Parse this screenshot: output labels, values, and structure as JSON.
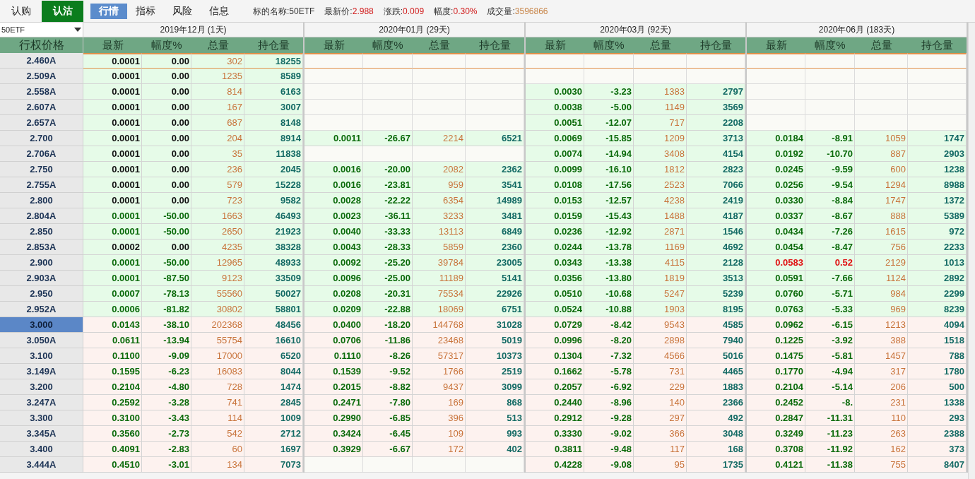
{
  "option_tabs": [
    {
      "label": "认购",
      "selected": false
    },
    {
      "label": "认沽",
      "selected": true
    }
  ],
  "view_tabs": [
    {
      "label": "行情",
      "selected": true
    },
    {
      "label": "指标",
      "selected": false
    },
    {
      "label": "风险",
      "selected": false
    },
    {
      "label": "信息",
      "selected": false
    }
  ],
  "quote": [
    {
      "label": "标的名称:",
      "value": "50ETF",
      "kind": "plain"
    },
    {
      "label": "最新价:",
      "value": "2.988",
      "kind": "price"
    },
    {
      "label": "涨跌:",
      "value": "0.009",
      "kind": "price"
    },
    {
      "label": "幅度:",
      "value": "0.30%",
      "kind": "price"
    },
    {
      "label": "成交量:",
      "value": "3596866",
      "kind": "volume"
    }
  ],
  "underlying_select": {
    "value": "50ETF"
  },
  "strike_header": "行权价格",
  "expiries": [
    {
      "title": "2019年12月 (1天)",
      "columns": [
        "最新",
        "幅度%",
        "总量",
        "持仓量"
      ]
    },
    {
      "title": "2020年01月 (29天)",
      "columns": [
        "最新",
        "幅度%",
        "总量",
        "持仓量"
      ]
    },
    {
      "title": "2020年03月 (92天)",
      "columns": [
        "最新",
        "幅度%",
        "总量",
        "持仓量"
      ]
    },
    {
      "title": "2020年06月 (183天)",
      "columns": [
        "最新",
        "幅度%",
        "总量",
        "持仓量"
      ]
    }
  ],
  "rows": [
    {
      "strike": "2.460A",
      "selected": false,
      "focused": true,
      "in_the_money": false,
      "quotes": [
        {
          "kind": "quote",
          "last": "0.0001",
          "chg": "0.00",
          "vol": "302",
          "oi": "18255",
          "color": "#111111"
        },
        {
          "kind": "blank"
        },
        {
          "kind": "blank"
        },
        {
          "kind": "blank"
        }
      ]
    },
    {
      "strike": "2.509A",
      "selected": false,
      "focused": false,
      "in_the_money": false,
      "quotes": [
        {
          "kind": "quote",
          "last": "0.0001",
          "chg": "0.00",
          "vol": "1235",
          "oi": "8589",
          "color": "#111111"
        },
        {
          "kind": "blank"
        },
        {
          "kind": "blank"
        },
        {
          "kind": "blank"
        }
      ]
    },
    {
      "strike": "2.558A",
      "selected": false,
      "focused": false,
      "in_the_money": false,
      "quotes": [
        {
          "kind": "quote",
          "last": "0.0001",
          "chg": "0.00",
          "vol": "814",
          "oi": "6163",
          "color": "#111111"
        },
        {
          "kind": "blank"
        },
        {
          "kind": "quote",
          "last": "0.0030",
          "chg": "-3.23",
          "vol": "1383",
          "oi": "2797",
          "color": "#0a6a0a"
        },
        {
          "kind": "blank"
        }
      ]
    },
    {
      "strike": "2.607A",
      "selected": false,
      "focused": false,
      "in_the_money": false,
      "quotes": [
        {
          "kind": "quote",
          "last": "0.0001",
          "chg": "0.00",
          "vol": "167",
          "oi": "3007",
          "color": "#111111"
        },
        {
          "kind": "blank"
        },
        {
          "kind": "quote",
          "last": "0.0038",
          "chg": "-5.00",
          "vol": "1149",
          "oi": "3569",
          "color": "#0a6a0a"
        },
        {
          "kind": "blank"
        }
      ]
    },
    {
      "strike": "2.657A",
      "selected": false,
      "focused": false,
      "in_the_money": false,
      "quotes": [
        {
          "kind": "quote",
          "last": "0.0001",
          "chg": "0.00",
          "vol": "687",
          "oi": "8148",
          "color": "#111111"
        },
        {
          "kind": "blank"
        },
        {
          "kind": "quote",
          "last": "0.0051",
          "chg": "-12.07",
          "vol": "717",
          "oi": "2208",
          "color": "#0a6a0a"
        },
        {
          "kind": "blank"
        }
      ]
    },
    {
      "strike": "2.700",
      "selected": false,
      "focused": false,
      "in_the_money": false,
      "quotes": [
        {
          "kind": "quote",
          "last": "0.0001",
          "chg": "0.00",
          "vol": "204",
          "oi": "8914",
          "color": "#111111"
        },
        {
          "kind": "quote",
          "last": "0.0011",
          "chg": "-26.67",
          "vol": "2214",
          "oi": "6521",
          "color": "#0a6a0a"
        },
        {
          "kind": "quote",
          "last": "0.0069",
          "chg": "-15.85",
          "vol": "1209",
          "oi": "3713",
          "color": "#0a6a0a"
        },
        {
          "kind": "quote",
          "last": "0.0184",
          "chg": "-8.91",
          "vol": "1059",
          "oi": "1747",
          "color": "#0a6a0a"
        }
      ]
    },
    {
      "strike": "2.706A",
      "selected": false,
      "focused": false,
      "in_the_money": false,
      "quotes": [
        {
          "kind": "quote",
          "last": "0.0001",
          "chg": "0.00",
          "vol": "35",
          "oi": "11838",
          "color": "#111111"
        },
        {
          "kind": "blank"
        },
        {
          "kind": "quote",
          "last": "0.0074",
          "chg": "-14.94",
          "vol": "3408",
          "oi": "4154",
          "color": "#0a6a0a"
        },
        {
          "kind": "quote",
          "last": "0.0192",
          "chg": "-10.70",
          "vol": "887",
          "oi": "2903",
          "color": "#0a6a0a"
        }
      ]
    },
    {
      "strike": "2.750",
      "selected": false,
      "focused": false,
      "in_the_money": false,
      "quotes": [
        {
          "kind": "quote",
          "last": "0.0001",
          "chg": "0.00",
          "vol": "236",
          "oi": "2045",
          "color": "#111111"
        },
        {
          "kind": "quote",
          "last": "0.0016",
          "chg": "-20.00",
          "vol": "2082",
          "oi": "2362",
          "color": "#0a6a0a"
        },
        {
          "kind": "quote",
          "last": "0.0099",
          "chg": "-16.10",
          "vol": "1812",
          "oi": "2823",
          "color": "#0a6a0a"
        },
        {
          "kind": "quote",
          "last": "0.0245",
          "chg": "-9.59",
          "vol": "600",
          "oi": "1238",
          "color": "#0a6a0a"
        }
      ]
    },
    {
      "strike": "2.755A",
      "selected": false,
      "focused": false,
      "in_the_money": false,
      "quotes": [
        {
          "kind": "quote",
          "last": "0.0001",
          "chg": "0.00",
          "vol": "579",
          "oi": "15228",
          "color": "#111111"
        },
        {
          "kind": "quote",
          "last": "0.0016",
          "chg": "-23.81",
          "vol": "959",
          "oi": "3541",
          "color": "#0a6a0a"
        },
        {
          "kind": "quote",
          "last": "0.0108",
          "chg": "-17.56",
          "vol": "2523",
          "oi": "7066",
          "color": "#0a6a0a"
        },
        {
          "kind": "quote",
          "last": "0.0256",
          "chg": "-9.54",
          "vol": "1294",
          "oi": "8988",
          "color": "#0a6a0a"
        }
      ]
    },
    {
      "strike": "2.800",
      "selected": false,
      "focused": false,
      "in_the_money": false,
      "quotes": [
        {
          "kind": "quote",
          "last": "0.0001",
          "chg": "0.00",
          "vol": "723",
          "oi": "9582",
          "color": "#111111"
        },
        {
          "kind": "quote",
          "last": "0.0028",
          "chg": "-22.22",
          "vol": "6354",
          "oi": "14989",
          "color": "#0a6a0a"
        },
        {
          "kind": "quote",
          "last": "0.0153",
          "chg": "-12.57",
          "vol": "4238",
          "oi": "2419",
          "color": "#0a6a0a"
        },
        {
          "kind": "quote",
          "last": "0.0330",
          "chg": "-8.84",
          "vol": "1747",
          "oi": "1372",
          "color": "#0a6a0a"
        }
      ]
    },
    {
      "strike": "2.804A",
      "selected": false,
      "focused": false,
      "in_the_money": false,
      "quotes": [
        {
          "kind": "quote",
          "last": "0.0001",
          "chg": "-50.00",
          "vol": "1663",
          "oi": "46493",
          "color": "#0a6a0a"
        },
        {
          "kind": "quote",
          "last": "0.0023",
          "chg": "-36.11",
          "vol": "3233",
          "oi": "3481",
          "color": "#0a6a0a"
        },
        {
          "kind": "quote",
          "last": "0.0159",
          "chg": "-15.43",
          "vol": "1488",
          "oi": "4187",
          "color": "#0a6a0a"
        },
        {
          "kind": "quote",
          "last": "0.0337",
          "chg": "-8.67",
          "vol": "888",
          "oi": "5389",
          "color": "#0a6a0a"
        }
      ]
    },
    {
      "strike": "2.850",
      "selected": false,
      "focused": false,
      "in_the_money": false,
      "quotes": [
        {
          "kind": "quote",
          "last": "0.0001",
          "chg": "-50.00",
          "vol": "2650",
          "oi": "21923",
          "color": "#0a6a0a"
        },
        {
          "kind": "quote",
          "last": "0.0040",
          "chg": "-33.33",
          "vol": "13113",
          "oi": "6849",
          "color": "#0a6a0a"
        },
        {
          "kind": "quote",
          "last": "0.0236",
          "chg": "-12.92",
          "vol": "2871",
          "oi": "1546",
          "color": "#0a6a0a"
        },
        {
          "kind": "quote",
          "last": "0.0434",
          "chg": "-7.26",
          "vol": "1615",
          "oi": "972",
          "color": "#0a6a0a"
        }
      ]
    },
    {
      "strike": "2.853A",
      "selected": false,
      "focused": false,
      "in_the_money": false,
      "quotes": [
        {
          "kind": "quote",
          "last": "0.0002",
          "chg": "0.00",
          "vol": "4235",
          "oi": "38328",
          "color": "#111111"
        },
        {
          "kind": "quote",
          "last": "0.0043",
          "chg": "-28.33",
          "vol": "5859",
          "oi": "2360",
          "color": "#0a6a0a"
        },
        {
          "kind": "quote",
          "last": "0.0244",
          "chg": "-13.78",
          "vol": "1169",
          "oi": "4692",
          "color": "#0a6a0a"
        },
        {
          "kind": "quote",
          "last": "0.0454",
          "chg": "-8.47",
          "vol": "756",
          "oi": "2233",
          "color": "#0a6a0a"
        }
      ]
    },
    {
      "strike": "2.900",
      "selected": false,
      "focused": false,
      "in_the_money": false,
      "quotes": [
        {
          "kind": "quote",
          "last": "0.0001",
          "chg": "-50.00",
          "vol": "12965",
          "oi": "48933",
          "color": "#0a6a0a"
        },
        {
          "kind": "quote",
          "last": "0.0092",
          "chg": "-25.20",
          "vol": "39784",
          "oi": "23005",
          "color": "#0a6a0a"
        },
        {
          "kind": "quote",
          "last": "0.0343",
          "chg": "-13.38",
          "vol": "4115",
          "oi": "2128",
          "color": "#0a6a0a"
        },
        {
          "kind": "quote",
          "last": "0.0583",
          "chg": "0.52",
          "vol": "2129",
          "oi": "1013",
          "color": "#e01010"
        }
      ]
    },
    {
      "strike": "2.903A",
      "selected": false,
      "focused": false,
      "in_the_money": false,
      "quotes": [
        {
          "kind": "quote",
          "last": "0.0001",
          "chg": "-87.50",
          "vol": "9123",
          "oi": "33509",
          "color": "#0a6a0a"
        },
        {
          "kind": "quote",
          "last": "0.0096",
          "chg": "-25.00",
          "vol": "11189",
          "oi": "5141",
          "color": "#0a6a0a"
        },
        {
          "kind": "quote",
          "last": "0.0356",
          "chg": "-13.80",
          "vol": "1819",
          "oi": "3513",
          "color": "#0a6a0a"
        },
        {
          "kind": "quote",
          "last": "0.0591",
          "chg": "-7.66",
          "vol": "1124",
          "oi": "2892",
          "color": "#0a6a0a"
        }
      ]
    },
    {
      "strike": "2.950",
      "selected": false,
      "focused": false,
      "in_the_money": false,
      "quotes": [
        {
          "kind": "quote",
          "last": "0.0007",
          "chg": "-78.13",
          "vol": "55560",
          "oi": "50027",
          "color": "#0a6a0a"
        },
        {
          "kind": "quote",
          "last": "0.0208",
          "chg": "-20.31",
          "vol": "75534",
          "oi": "22926",
          "color": "#0a6a0a"
        },
        {
          "kind": "quote",
          "last": "0.0510",
          "chg": "-10.68",
          "vol": "5247",
          "oi": "5239",
          "color": "#0a6a0a"
        },
        {
          "kind": "quote",
          "last": "0.0760",
          "chg": "-5.71",
          "vol": "984",
          "oi": "2299",
          "color": "#0a6a0a"
        }
      ]
    },
    {
      "strike": "2.952A",
      "selected": false,
      "focused": false,
      "in_the_money": false,
      "quotes": [
        {
          "kind": "quote",
          "last": "0.0006",
          "chg": "-81.82",
          "vol": "30802",
          "oi": "58801",
          "color": "#0a6a0a"
        },
        {
          "kind": "quote",
          "last": "0.0209",
          "chg": "-22.88",
          "vol": "18069",
          "oi": "6751",
          "color": "#0a6a0a"
        },
        {
          "kind": "quote",
          "last": "0.0524",
          "chg": "-10.88",
          "vol": "1903",
          "oi": "8195",
          "color": "#0a6a0a"
        },
        {
          "kind": "quote",
          "last": "0.0763",
          "chg": "-5.33",
          "vol": "969",
          "oi": "8239",
          "color": "#0a6a0a"
        }
      ]
    },
    {
      "strike": "3.000",
      "selected": true,
      "focused": false,
      "in_the_money": true,
      "quotes": [
        {
          "kind": "quote",
          "last": "0.0143",
          "chg": "-38.10",
          "vol": "202368",
          "oi": "48456",
          "color": "#0a6a0a"
        },
        {
          "kind": "quote",
          "last": "0.0400",
          "chg": "-18.20",
          "vol": "144768",
          "oi": "31028",
          "color": "#0a6a0a"
        },
        {
          "kind": "quote",
          "last": "0.0729",
          "chg": "-8.42",
          "vol": "9543",
          "oi": "4585",
          "color": "#0a6a0a"
        },
        {
          "kind": "quote",
          "last": "0.0962",
          "chg": "-6.15",
          "vol": "1213",
          "oi": "4094",
          "color": "#0a6a0a"
        }
      ]
    },
    {
      "strike": "3.050A",
      "selected": false,
      "focused": false,
      "in_the_money": true,
      "quotes": [
        {
          "kind": "quote",
          "last": "0.0611",
          "chg": "-13.94",
          "vol": "55754",
          "oi": "16610",
          "color": "#0a6a0a"
        },
        {
          "kind": "quote",
          "last": "0.0706",
          "chg": "-11.86",
          "vol": "23468",
          "oi": "5019",
          "color": "#0a6a0a"
        },
        {
          "kind": "quote",
          "last": "0.0996",
          "chg": "-8.20",
          "vol": "2898",
          "oi": "7940",
          "color": "#0a6a0a"
        },
        {
          "kind": "quote",
          "last": "0.1225",
          "chg": "-3.92",
          "vol": "388",
          "oi": "1518",
          "color": "#0a6a0a"
        }
      ]
    },
    {
      "strike": "3.100",
      "selected": false,
      "focused": false,
      "in_the_money": true,
      "quotes": [
        {
          "kind": "quote",
          "last": "0.1100",
          "chg": "-9.09",
          "vol": "17000",
          "oi": "6520",
          "color": "#0a6a0a"
        },
        {
          "kind": "quote",
          "last": "0.1110",
          "chg": "-8.26",
          "vol": "57317",
          "oi": "10373",
          "color": "#0a6a0a"
        },
        {
          "kind": "quote",
          "last": "0.1304",
          "chg": "-7.32",
          "vol": "4566",
          "oi": "5016",
          "color": "#0a6a0a"
        },
        {
          "kind": "quote",
          "last": "0.1475",
          "chg": "-5.81",
          "vol": "1457",
          "oi": "788",
          "color": "#0a6a0a"
        }
      ]
    },
    {
      "strike": "3.149A",
      "selected": false,
      "focused": false,
      "in_the_money": true,
      "quotes": [
        {
          "kind": "quote",
          "last": "0.1595",
          "chg": "-6.23",
          "vol": "16083",
          "oi": "8044",
          "color": "#0a6a0a"
        },
        {
          "kind": "quote",
          "last": "0.1539",
          "chg": "-9.52",
          "vol": "1766",
          "oi": "2519",
          "color": "#0a6a0a"
        },
        {
          "kind": "quote",
          "last": "0.1662",
          "chg": "-5.78",
          "vol": "731",
          "oi": "4465",
          "color": "#0a6a0a"
        },
        {
          "kind": "quote",
          "last": "0.1770",
          "chg": "-4.94",
          "vol": "317",
          "oi": "1780",
          "color": "#0a6a0a"
        }
      ]
    },
    {
      "strike": "3.200",
      "selected": false,
      "focused": false,
      "in_the_money": true,
      "quotes": [
        {
          "kind": "quote",
          "last": "0.2104",
          "chg": "-4.80",
          "vol": "728",
          "oi": "1474",
          "color": "#0a6a0a"
        },
        {
          "kind": "quote",
          "last": "0.2015",
          "chg": "-8.82",
          "vol": "9437",
          "oi": "3099",
          "color": "#0a6a0a"
        },
        {
          "kind": "quote",
          "last": "0.2057",
          "chg": "-6.92",
          "vol": "229",
          "oi": "1883",
          "color": "#0a6a0a"
        },
        {
          "kind": "quote",
          "last": "0.2104",
          "chg": "-5.14",
          "vol": "206",
          "oi": "500",
          "color": "#0a6a0a"
        }
      ]
    },
    {
      "strike": "3.247A",
      "selected": false,
      "focused": false,
      "in_the_money": true,
      "quotes": [
        {
          "kind": "quote",
          "last": "0.2592",
          "chg": "-3.28",
          "vol": "741",
          "oi": "2845",
          "color": "#0a6a0a"
        },
        {
          "kind": "quote",
          "last": "0.2471",
          "chg": "-7.80",
          "vol": "169",
          "oi": "868",
          "color": "#0a6a0a"
        },
        {
          "kind": "quote",
          "last": "0.2440",
          "chg": "-8.96",
          "vol": "140",
          "oi": "2366",
          "color": "#0a6a0a"
        },
        {
          "kind": "quote",
          "last": "0.2452",
          "chg": "-8.",
          "vol": "231",
          "oi": "1338",
          "color": "#0a6a0a"
        }
      ]
    },
    {
      "strike": "3.300",
      "selected": false,
      "focused": false,
      "in_the_money": true,
      "quotes": [
        {
          "kind": "quote",
          "last": "0.3100",
          "chg": "-3.43",
          "vol": "114",
          "oi": "1009",
          "color": "#0a6a0a"
        },
        {
          "kind": "quote",
          "last": "0.2990",
          "chg": "-6.85",
          "vol": "396",
          "oi": "513",
          "color": "#0a6a0a"
        },
        {
          "kind": "quote",
          "last": "0.2912",
          "chg": "-9.28",
          "vol": "297",
          "oi": "492",
          "color": "#0a6a0a"
        },
        {
          "kind": "quote",
          "last": "0.2847",
          "chg": "-11.31",
          "vol": "110",
          "oi": "293",
          "color": "#0a6a0a"
        }
      ]
    },
    {
      "strike": "3.345A",
      "selected": false,
      "focused": false,
      "in_the_money": true,
      "quotes": [
        {
          "kind": "quote",
          "last": "0.3560",
          "chg": "-2.73",
          "vol": "542",
          "oi": "2712",
          "color": "#0a6a0a"
        },
        {
          "kind": "quote",
          "last": "0.3424",
          "chg": "-6.45",
          "vol": "109",
          "oi": "993",
          "color": "#0a6a0a"
        },
        {
          "kind": "quote",
          "last": "0.3330",
          "chg": "-9.02",
          "vol": "366",
          "oi": "3048",
          "color": "#0a6a0a"
        },
        {
          "kind": "quote",
          "last": "0.3249",
          "chg": "-11.23",
          "vol": "263",
          "oi": "2388",
          "color": "#0a6a0a"
        }
      ]
    },
    {
      "strike": "3.400",
      "selected": false,
      "focused": false,
      "in_the_money": true,
      "quotes": [
        {
          "kind": "quote",
          "last": "0.4091",
          "chg": "-2.83",
          "vol": "60",
          "oi": "1697",
          "color": "#0a6a0a"
        },
        {
          "kind": "quote",
          "last": "0.3929",
          "chg": "-6.67",
          "vol": "172",
          "oi": "402",
          "color": "#0a6a0a"
        },
        {
          "kind": "quote",
          "last": "0.3811",
          "chg": "-9.48",
          "vol": "117",
          "oi": "168",
          "color": "#0a6a0a"
        },
        {
          "kind": "quote",
          "last": "0.3708",
          "chg": "-11.92",
          "vol": "162",
          "oi": "373",
          "color": "#0a6a0a"
        }
      ]
    },
    {
      "strike": "3.444A",
      "selected": false,
      "focused": false,
      "in_the_money": true,
      "quotes": [
        {
          "kind": "quote",
          "last": "0.4510",
          "chg": "-3.01",
          "vol": "134",
          "oi": "7073",
          "color": "#0a6a0a"
        },
        {
          "kind": "blank"
        },
        {
          "kind": "quote",
          "last": "0.4228",
          "chg": "-9.08",
          "vol": "95",
          "oi": "1735",
          "color": "#0a6a0a"
        },
        {
          "kind": "quote",
          "last": "0.4121",
          "chg": "-11.38",
          "vol": "755",
          "oi": "8407",
          "color": "#0a6a0a"
        }
      ]
    }
  ]
}
